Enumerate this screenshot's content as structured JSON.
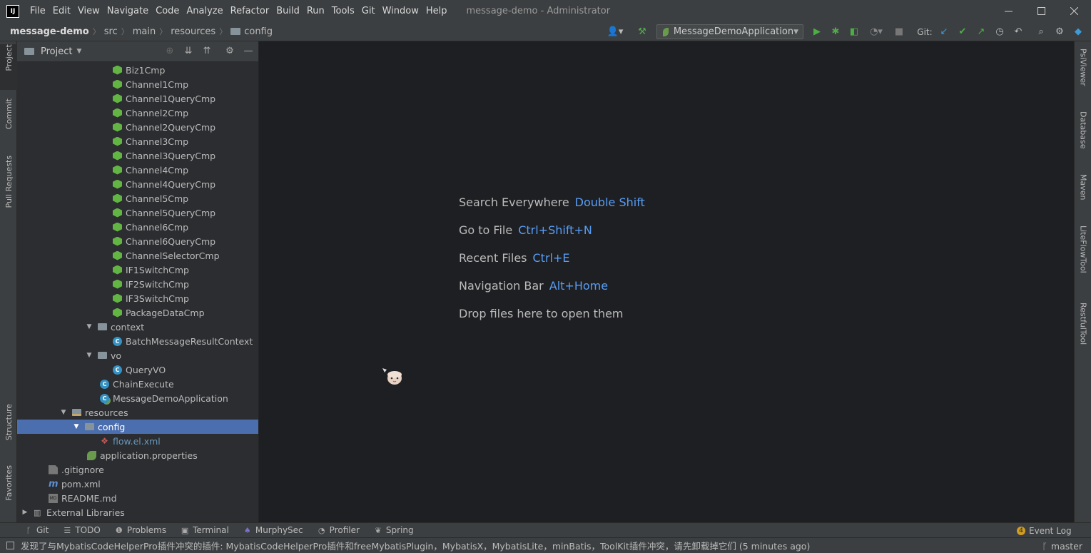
{
  "titlebar": {
    "logo": "IJ",
    "menu": [
      "File",
      "Edit",
      "View",
      "Navigate",
      "Code",
      "Analyze",
      "Refactor",
      "Build",
      "Run",
      "Tools",
      "Git",
      "Window",
      "Help"
    ],
    "window_title": "message-demo - Administrator"
  },
  "breadcrumb": [
    "message-demo",
    "src",
    "main",
    "resources",
    "config"
  ],
  "toolbar": {
    "run_config": "MessageDemoApplication",
    "git_label": "Git:"
  },
  "left_tabs": [
    "Project",
    "Commit",
    "Pull Requests",
    "Structure",
    "Favorites"
  ],
  "right_tabs": [
    "PsiViewer",
    "Database",
    "Maven",
    "LiteFlowTool",
    "RestfulTool"
  ],
  "project_panel": {
    "title": "Project",
    "tree": [
      {
        "label": "Biz1Cmp",
        "icon": "component-icon"
      },
      {
        "label": "Channel1Cmp",
        "icon": "component-icon"
      },
      {
        "label": "Channel1QueryCmp",
        "icon": "component-icon"
      },
      {
        "label": "Channel2Cmp",
        "icon": "component-icon"
      },
      {
        "label": "Channel2QueryCmp",
        "icon": "component-icon"
      },
      {
        "label": "Channel3Cmp",
        "icon": "component-icon"
      },
      {
        "label": "Channel3QueryCmp",
        "icon": "component-icon"
      },
      {
        "label": "Channel4Cmp",
        "icon": "component-icon"
      },
      {
        "label": "Channel4QueryCmp",
        "icon": "component-icon"
      },
      {
        "label": "Channel5Cmp",
        "icon": "component-icon"
      },
      {
        "label": "Channel5QueryCmp",
        "icon": "component-icon"
      },
      {
        "label": "Channel6Cmp",
        "icon": "component-icon"
      },
      {
        "label": "Channel6QueryCmp",
        "icon": "component-icon"
      },
      {
        "label": "ChannelSelectorCmp",
        "icon": "component-icon"
      },
      {
        "label": "IF1SwitchCmp",
        "icon": "component-icon"
      },
      {
        "label": "IF2SwitchCmp",
        "icon": "component-icon"
      },
      {
        "label": "IF3SwitchCmp",
        "icon": "component-icon"
      },
      {
        "label": "PackageDataCmp",
        "icon": "component-icon"
      },
      {
        "label": "context",
        "icon": "package-folder-icon"
      },
      {
        "label": "BatchMessageResultContext",
        "icon": "class-icon"
      },
      {
        "label": "vo",
        "icon": "package-folder-icon"
      },
      {
        "label": "QueryVO",
        "icon": "class-icon"
      },
      {
        "label": "ChainExecute",
        "icon": "class-icon"
      },
      {
        "label": "MessageDemoApplication",
        "icon": "spring-boot-class-icon"
      },
      {
        "label": "resources",
        "icon": "resources-folder-icon"
      },
      {
        "label": "config",
        "icon": "folder-icon"
      },
      {
        "label": "flow.el.xml",
        "icon": "liteflow-xml-icon"
      },
      {
        "label": "application.properties",
        "icon": "properties-icon"
      },
      {
        "label": ".gitignore",
        "icon": "gitignore-icon"
      },
      {
        "label": "pom.xml",
        "icon": "maven-icon"
      },
      {
        "label": "README.md",
        "icon": "markdown-icon"
      },
      {
        "label": "External Libraries",
        "icon": "libraries-icon"
      }
    ]
  },
  "editor_hints": [
    {
      "label": "Search Everywhere",
      "key": "Double Shift"
    },
    {
      "label": "Go to File",
      "key": "Ctrl+Shift+N"
    },
    {
      "label": "Recent Files",
      "key": "Ctrl+E"
    },
    {
      "label": "Navigation Bar",
      "key": "Alt+Home"
    },
    {
      "label": "Drop files here to open them",
      "key": ""
    }
  ],
  "bottom_tabs": [
    "Git",
    "TODO",
    "Problems",
    "Terminal",
    "MurphySec",
    "Profiler",
    "Spring"
  ],
  "event_log": {
    "label": "Event Log",
    "count": "4"
  },
  "status": {
    "message": "发现了与MybatisCodeHelperPro插件冲突的插件: MybatisCodeHelperPro插件和freeMybatisPlugin，MybatisX，MybatisLite，minBatis，ToolKit插件冲突，请先卸载掉它们 (5 minutes ago)",
    "branch": "master"
  },
  "colors": {
    "accent": "#4b6eaf",
    "shortcut": "#589df6",
    "component": "#62b543"
  }
}
